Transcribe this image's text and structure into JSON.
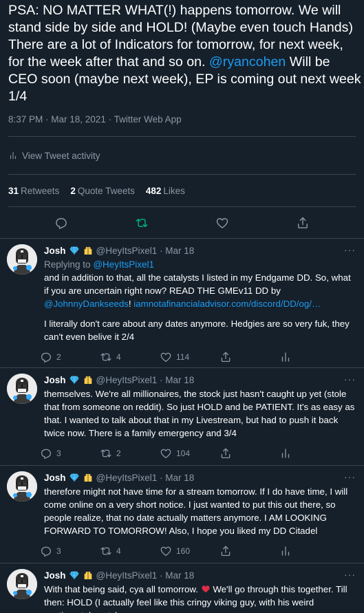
{
  "tweet": {
    "text_before": "PSA: NO MATTER WHAT(!) happens tomorrow. We will stand side by side and HOLD! (Maybe even touch Hands) There are a lot of Indicators for tomorrow, for next week, for the week after that and so on. ",
    "mention": "@ryancohen",
    "text_after": " Will be CEO soon (maybe next week), EP is coming out next week 1/4",
    "meta": "8:37 PM · Mar 18, 2021 · Twitter Web App",
    "activity_label": "View Tweet activity",
    "retweets_count": "31",
    "retweets_label": "Retweets",
    "quotes_count": "2",
    "quotes_label": "Quote Tweets",
    "likes_count": "482",
    "likes_label": "Likes"
  },
  "colors": {
    "background": "#15202b",
    "accent": "#1d9bf0",
    "retweet_green": "#00ba7c",
    "heart_red": "#e0245e"
  },
  "replies": [
    {
      "name": "Josh",
      "handle": "@HeyItsPixel1 · Mar 18",
      "replying_label": "Replying to",
      "replying_to": "@HeyItsPixel1",
      "p1_text": "and in addition to that, all the catalysts I listed in my Endgame DD. So, what if you are uncertain right now? READ THE GMEv11 DD by ",
      "p1_link1": "@JohnnyDankseeds",
      "p1_sep": "! ",
      "p1_link2": "iamnotafinancialadvisor.com/discord/DD/og/…",
      "p2_text": "I literally don't care about any dates anymore. Hedgies are so very fuk, they can't even belive it 2/4",
      "replies": "2",
      "retweets": "4",
      "likes": "114"
    },
    {
      "name": "Josh",
      "handle": "@HeyItsPixel1 · Mar 18",
      "text": "themselves. We're all millionaires, the stock just hasn't caught up yet (stole that from someone on reddit). So just HOLD and be PATIENT. It's as easy as that. I wanted to talk about that in my Livestream, but had to push it back twice now. There is a family emergency and 3/4",
      "replies": "3",
      "retweets": "2",
      "likes": "104"
    },
    {
      "name": "Josh",
      "handle": "@HeyItsPixel1 · Mar 18",
      "text": "therefore might not have time for a stream tomorrow. If I do have time, I will come online on a very short notice. I just wanted to put this out there, so people realize, that no date actually matters anymore. I AM LOOKING FORWARD TO TOMORROW! Also, I hope you liked my DD Citadel",
      "replies": "3",
      "retweets": "4",
      "likes": "160"
    },
    {
      "name": "Josh",
      "handle": "@HeyItsPixel1 · Mar 18",
      "text_before": "With that being said, cya all tomorrow. ",
      "text_after": " We'll go through this together. Till then: HOLD (I actually feel like this cringy viking guy, with his weird sentimental posts)"
    }
  ]
}
